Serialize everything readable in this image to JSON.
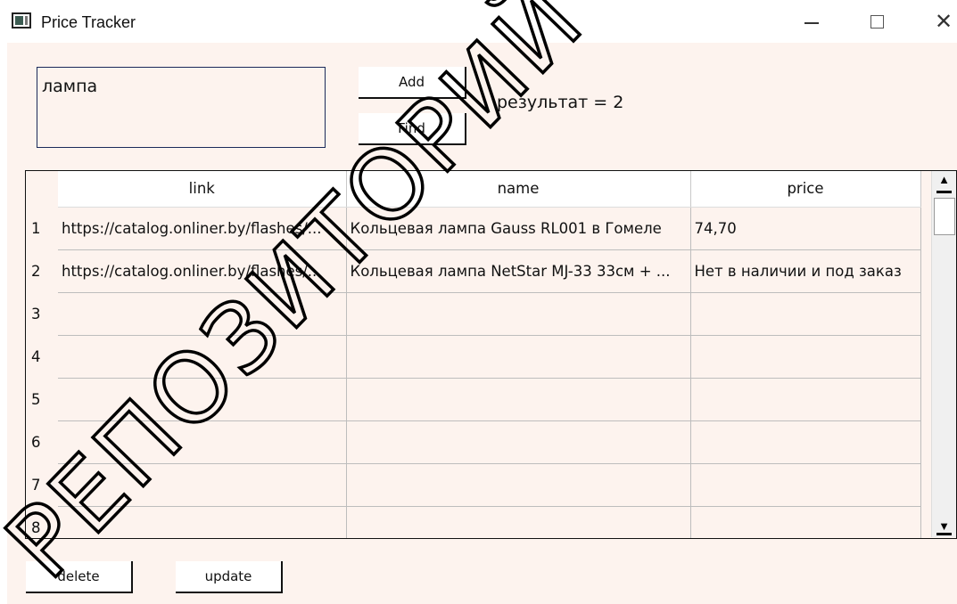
{
  "window": {
    "title": "Price Tracker",
    "minimize_glyph": "—",
    "close_glyph": "✕"
  },
  "search": {
    "value": "лампа"
  },
  "buttons": {
    "add": "Add",
    "find": "Find",
    "delete": "delete",
    "update": "update"
  },
  "result_text": "результат = 2",
  "table": {
    "columns": [
      "link",
      "name",
      "price"
    ],
    "rows": [
      {
        "num": "1",
        "link": "https://catalog.onliner.by/flashes/...",
        "name": "Кольцевая лампа Gauss RL001 в Гомеле",
        "price": "74,70"
      },
      {
        "num": "2",
        "link": "https://catalog.onliner.by/flashes/...",
        "name": "Кольцевая лампа NetStar MJ-33 33см + ...",
        "price": "Нет в наличии и под заказ"
      },
      {
        "num": "3",
        "link": "",
        "name": "",
        "price": ""
      },
      {
        "num": "4",
        "link": "",
        "name": "",
        "price": ""
      },
      {
        "num": "5",
        "link": "",
        "name": "",
        "price": ""
      },
      {
        "num": "6",
        "link": "",
        "name": "",
        "price": ""
      },
      {
        "num": "7",
        "link": "",
        "name": "",
        "price": ""
      },
      {
        "num": "8",
        "link": "",
        "name": "",
        "price": ""
      }
    ]
  },
  "scrollbar": {
    "up_glyph": "▲",
    "down_glyph": "▼"
  },
  "watermark": {
    "text": "РЕПОЗИТОРИЙ ГГУ"
  },
  "colors": {
    "client_background": "#fdf3ee",
    "header_background": "#ffffff",
    "border": "#111111"
  },
  "icons": [
    "app-icon",
    "minimize-icon",
    "maximize-icon",
    "close-icon",
    "scroll-up-icon",
    "scroll-down-icon"
  ]
}
